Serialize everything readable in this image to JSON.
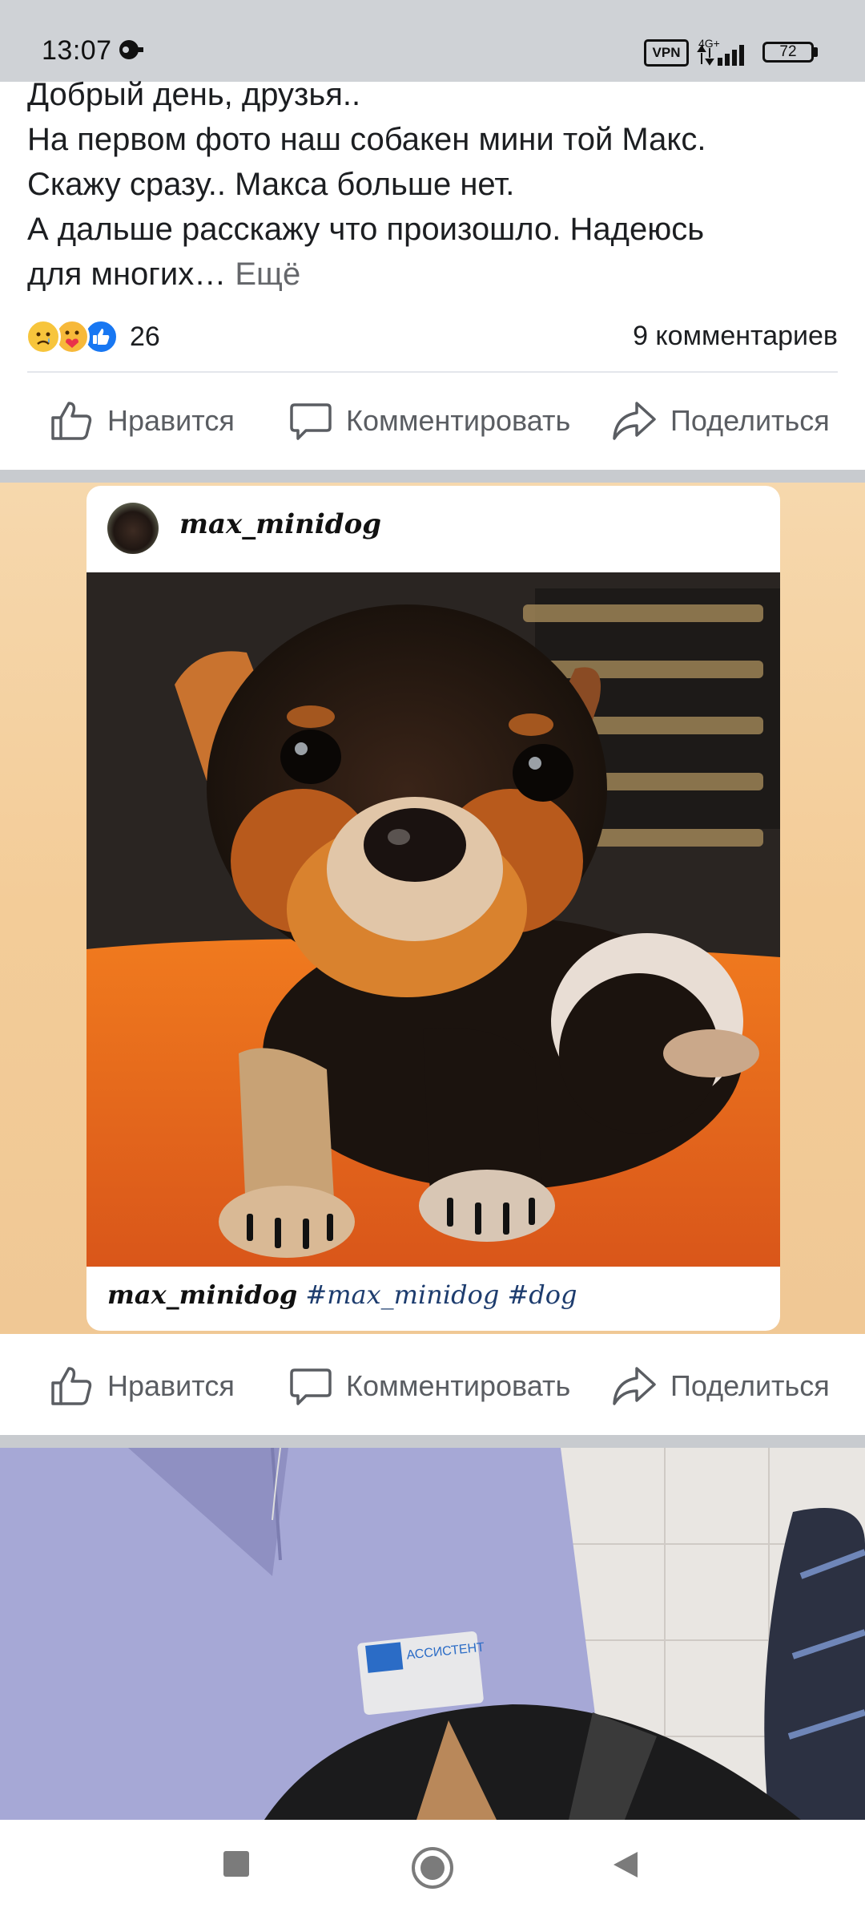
{
  "status_bar": {
    "time": "13:07",
    "vpn": "VPN",
    "network": "4G+",
    "battery": "72"
  },
  "post": {
    "lines": [
      "Добрый день, друзья..",
      "На первом фото наш собакен мини той Макс.",
      "Скажу сразу.. Макса больше нет.",
      "А дальше расскажу что произошло. Надеюсь",
      "для многих…"
    ],
    "see_more": "Ещё",
    "reactions_count": "26",
    "reaction_icons": [
      "sad-reaction-icon",
      "care-reaction-icon",
      "like-reaction-icon"
    ],
    "comments": "9 комментариев"
  },
  "actions": {
    "like": "Нравится",
    "comment": "Комментировать",
    "share": "Поделиться"
  },
  "photo1": {
    "username": "max_minidog",
    "caption_user": "max_minidog",
    "caption_tags": "#max_minidog #dog"
  },
  "photo2": {
    "badge": "АССИСТЕНТ"
  },
  "colors": {
    "like_blue": "#1877f2",
    "separator": "#c8cbcf",
    "photo1_background": "#f3cc98",
    "scrub_purple": "#a6a8d6"
  }
}
